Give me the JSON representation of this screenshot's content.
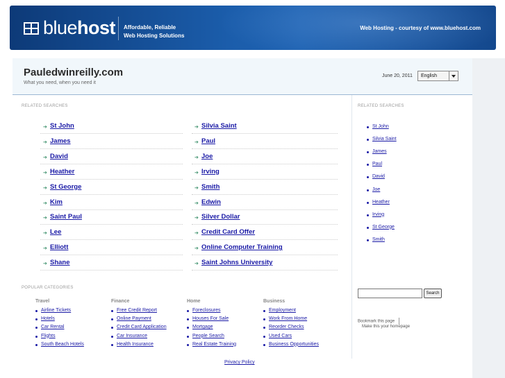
{
  "header": {
    "logo_light": "blue",
    "logo_bold": "host",
    "tagline_line1": "Affordable, Reliable",
    "tagline_line2": "Web Hosting Solutions",
    "courtesy": "Web Hosting - courtesy of www.bluehost.com"
  },
  "site": {
    "title": "Pauledwinreilly.com",
    "subtitle": "What you need, when you need it",
    "date": "June 20, 2011",
    "language": "English"
  },
  "related": {
    "label": "RELATED SEARCHES",
    "left": [
      "St John",
      "James",
      "David",
      "Heather",
      "St George",
      "Kim",
      "Saint Paul",
      "Lee",
      "Elliott",
      "Shane"
    ],
    "right": [
      "Silvia Saint",
      "Paul",
      "Joe",
      "Irving",
      "Smith",
      "Edwin",
      "Silver Dollar",
      "Credit Card Offer",
      "Online Computer Training",
      "Saint Johns University"
    ]
  },
  "sidebar": {
    "label": "RELATED SEARCHES",
    "items": [
      "St John",
      "Silvia Saint",
      "James",
      "Paul",
      "David",
      "Joe",
      "Heather",
      "Irving",
      "St George",
      "Smith"
    ],
    "search_button": "Search",
    "bookmark": "Bookmark this page",
    "homepage": "Make this your homepage"
  },
  "popular": {
    "label": "POPULAR CATEGORIES",
    "columns": [
      {
        "title": "Travel",
        "items": [
          "Airline Tickets",
          "Hotels",
          "Car Rental",
          "Flights",
          "South Beach Hotels"
        ]
      },
      {
        "title": "Finance",
        "items": [
          "Free Credit Report",
          "Online Payment",
          "Credit Card Application",
          "Car Insurance",
          "Health Insurance"
        ]
      },
      {
        "title": "Home",
        "items": [
          "Foreclosures",
          "Houses For Sale",
          "Mortgage",
          "People Search",
          "Real Estate Training"
        ]
      },
      {
        "title": "Business",
        "items": [
          "Employment",
          "Work From Home",
          "Reorder Checks",
          "Used Cars",
          "Business Opportunities"
        ]
      }
    ]
  },
  "footer": {
    "privacy": "Privacy Policy"
  },
  "colors": {
    "link": "#1a1aa6",
    "header": "#1b5dab",
    "arrow": "#3a8f6a"
  }
}
